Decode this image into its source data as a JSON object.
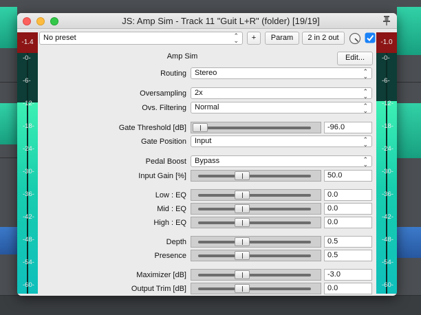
{
  "window": {
    "title": "JS: Amp Sim - Track 11 \"Guit L+R\" (folder) [19/19]"
  },
  "toolbar": {
    "preset": "No preset",
    "add_label": "+",
    "param_label": "Param",
    "io_label": "2 in 2 out",
    "enabled": true
  },
  "meters": {
    "left_peak": "-1.4",
    "right_peak": "-1.0",
    "ticks": [
      "-0-",
      "-6-",
      "-12-",
      "-18-",
      "-24-",
      "-30-",
      "-36-",
      "-42-",
      "-48-",
      "-54-",
      "-60-"
    ],
    "fill_color_top": "#3df0b3",
    "fill_color_bottom": "#0fbfbb",
    "peak_color": "#8d1515"
  },
  "plugin": {
    "name": "Amp Sim",
    "edit_label": "Edit..."
  },
  "params": {
    "routing": {
      "label": "Routing",
      "value": "Stereo"
    },
    "oversampling": {
      "label": "Oversampling",
      "value": "2x"
    },
    "ovs_filter": {
      "label": "Ovs. Filtering",
      "value": "Normal"
    },
    "gate_thresh": {
      "label": "Gate Threshold [dB]",
      "value": "-96.0",
      "position": 0.0
    },
    "gate_pos": {
      "label": "Gate Position",
      "value": "Input"
    },
    "pedal_boost": {
      "label": "Pedal Boost",
      "value": "Bypass"
    },
    "input_gain": {
      "label": "Input Gain [%]",
      "value": "50.0",
      "position": 0.5
    },
    "low_eq": {
      "label": "Low : EQ",
      "value": "0.0",
      "position": 0.5
    },
    "mid_eq": {
      "label": "Mid : EQ",
      "value": "0.0",
      "position": 0.5
    },
    "high_eq": {
      "label": "High : EQ",
      "value": "0.0",
      "position": 0.5
    },
    "depth": {
      "label": "Depth",
      "value": "0.5",
      "position": 0.5
    },
    "presence": {
      "label": "Presence",
      "value": "0.5",
      "position": 0.5
    },
    "maximizer": {
      "label": "Maximizer [dB]",
      "value": "-3.0",
      "position": 0.5
    },
    "output_trim": {
      "label": "Output Trim [dB]",
      "value": "0.0",
      "position": 0.5
    }
  }
}
